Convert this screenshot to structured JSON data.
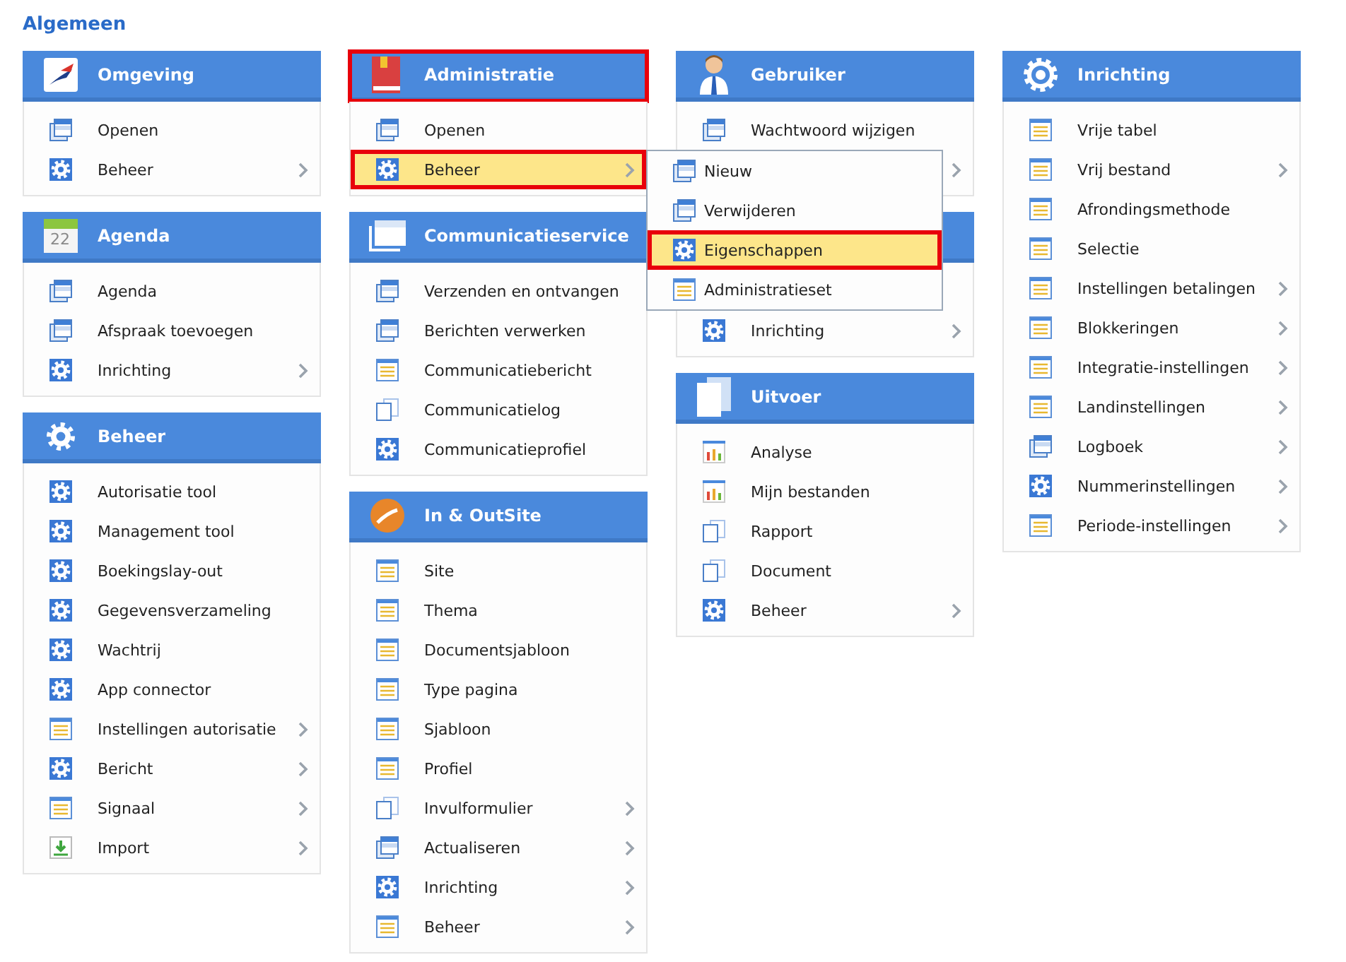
{
  "title": "Algemeen",
  "columns": [
    {
      "cards": [
        {
          "header": {
            "title": "Omgeving",
            "kind": "logo"
          },
          "items": [
            {
              "label": "Openen",
              "kind": "window",
              "submenu": false
            },
            {
              "label": "Beheer",
              "kind": "gear",
              "submenu": true
            }
          ]
        },
        {
          "header": {
            "title": "Agenda",
            "kind": "calendar",
            "date": "22"
          },
          "items": [
            {
              "label": "Agenda",
              "kind": "window",
              "submenu": false
            },
            {
              "label": "Afspraak toevoegen",
              "kind": "window",
              "submenu": false
            },
            {
              "label": "Inrichting",
              "kind": "gear",
              "submenu": true
            }
          ]
        },
        {
          "header": {
            "title": "Beheer",
            "kind": "whitegear"
          },
          "items": [
            {
              "label": "Autorisatie tool",
              "kind": "gear",
              "submenu": false
            },
            {
              "label": "Management tool",
              "kind": "gear",
              "submenu": false
            },
            {
              "label": "Boekingslay-out",
              "kind": "gear",
              "submenu": false
            },
            {
              "label": "Gegevensverzameling",
              "kind": "gear",
              "submenu": false
            },
            {
              "label": "Wachtrij",
              "kind": "gear",
              "submenu": false
            },
            {
              "label": "App connector",
              "kind": "gear",
              "submenu": false
            },
            {
              "label": "Instellingen autorisatie",
              "kind": "list",
              "submenu": true
            },
            {
              "label": "Bericht",
              "kind": "gear",
              "submenu": true
            },
            {
              "label": "Signaal",
              "kind": "list",
              "submenu": true
            },
            {
              "label": "Import",
              "kind": "import",
              "submenu": true
            }
          ]
        }
      ]
    },
    {
      "cards": [
        {
          "header": {
            "title": "Administratie",
            "kind": "book",
            "highlighted": true
          },
          "items": [
            {
              "label": "Openen",
              "kind": "window",
              "submenu": false
            },
            {
              "label": "Beheer",
              "kind": "gear",
              "submenu": true,
              "selected": true,
              "highlighted": true,
              "popup": [
                {
                  "label": "Nieuw",
                  "kind": "window",
                  "selected": false,
                  "highlighted": false
                },
                {
                  "label": "Verwijderen",
                  "kind": "window",
                  "selected": false,
                  "highlighted": false
                },
                {
                  "label": "Eigenschappen",
                  "kind": "gear",
                  "selected": true,
                  "highlighted": true
                },
                {
                  "label": "Administratieset",
                  "kind": "list",
                  "selected": false,
                  "highlighted": false
                }
              ]
            }
          ]
        },
        {
          "header": {
            "title": "Communicatieservice",
            "kind": "windows"
          },
          "items": [
            {
              "label": "Verzenden en ontvangen",
              "kind": "window",
              "submenu": false
            },
            {
              "label": "Berichten verwerken",
              "kind": "window",
              "submenu": false
            },
            {
              "label": "Communicatiebericht",
              "kind": "list",
              "submenu": false
            },
            {
              "label": "Communicatielog",
              "kind": "pages",
              "submenu": false
            },
            {
              "label": "Communicatieprofiel",
              "kind": "gear",
              "submenu": false
            }
          ]
        },
        {
          "header": {
            "title": "In & OutSite",
            "kind": "orange"
          },
          "items": [
            {
              "label": "Site",
              "kind": "list",
              "submenu": false
            },
            {
              "label": "Thema",
              "kind": "list",
              "submenu": false
            },
            {
              "label": "Documentsjabloon",
              "kind": "list",
              "submenu": false
            },
            {
              "label": "Type pagina",
              "kind": "list",
              "submenu": false
            },
            {
              "label": "Sjabloon",
              "kind": "list",
              "submenu": false
            },
            {
              "label": "Profiel",
              "kind": "list",
              "submenu": false
            },
            {
              "label": "Invulformulier",
              "kind": "pages",
              "submenu": true
            },
            {
              "label": "Actualiseren",
              "kind": "window",
              "submenu": true
            },
            {
              "label": "Inrichting",
              "kind": "gear",
              "submenu": true
            },
            {
              "label": "Beheer",
              "kind": "list",
              "submenu": true
            }
          ]
        }
      ]
    },
    {
      "cards": [
        {
          "header": {
            "title": "Gebruiker",
            "kind": "user"
          },
          "items": [
            {
              "label": "Wachtwoord wijzigen",
              "kind": "window",
              "submenu": false
            },
            {
              "submenu": true
            }
          ]
        },
        {
          "items": [
            {
              "submenu": false
            },
            {
              "label": "Inrichting",
              "kind": "gear",
              "submenu": true
            }
          ]
        },
        {
          "header": {
            "title": "Uitvoer",
            "kind": "bigpages"
          },
          "items": [
            {
              "label": "Analyse",
              "kind": "chart",
              "submenu": false
            },
            {
              "label": "Mijn bestanden",
              "kind": "chart",
              "submenu": false
            },
            {
              "label": "Rapport",
              "kind": "pages",
              "submenu": false
            },
            {
              "label": "Document",
              "kind": "pages",
              "submenu": false
            },
            {
              "label": "Beheer",
              "kind": "gear",
              "submenu": true
            }
          ]
        }
      ]
    },
    {
      "cards": [
        {
          "header": {
            "title": "Inrichting",
            "kind": "biggear"
          },
          "items": [
            {
              "label": "Vrije tabel",
              "kind": "list",
              "submenu": false
            },
            {
              "label": "Vrij bestand",
              "kind": "list",
              "submenu": true
            },
            {
              "label": "Afrondingsmethode",
              "kind": "list",
              "submenu": false
            },
            {
              "label": "Selectie",
              "kind": "list",
              "submenu": false
            },
            {
              "label": "Instellingen betalingen",
              "kind": "list",
              "submenu": true
            },
            {
              "label": "Blokkeringen",
              "kind": "list",
              "submenu": true
            },
            {
              "label": "Integratie-instellingen",
              "kind": "list",
              "submenu": true
            },
            {
              "label": "Landinstellingen",
              "kind": "list",
              "submenu": true
            },
            {
              "label": "Logboek",
              "kind": "window",
              "submenu": true
            },
            {
              "label": "Nummerinstellingen",
              "kind": "gear",
              "submenu": true
            },
            {
              "label": "Periode-instellingen",
              "kind": "list",
              "submenu": true
            }
          ]
        }
      ]
    }
  ]
}
